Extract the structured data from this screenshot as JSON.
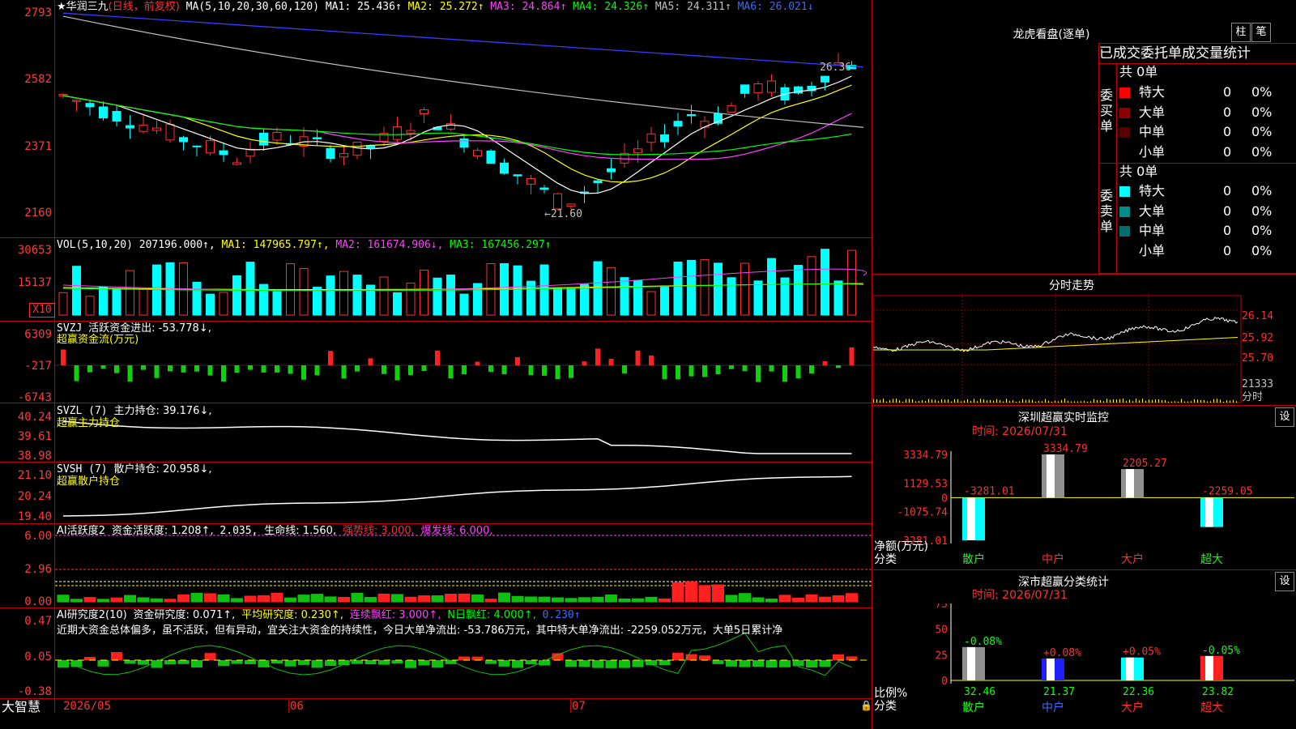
{
  "stock": {
    "name": "华润三九",
    "mode": "(日线，前复权)",
    "ma_label": "MA(5,10,20,30,60,120)",
    "ma1": "MA1: 25.436↑",
    "ma2": "MA2: 25.272↑",
    "ma3": "MA3: 24.864↑",
    "ma4": "MA4: 24.326↑",
    "ma5": "MA5: 24.311↑",
    "ma6": "MA6: 26.021↓",
    "y_ticks": [
      "2793",
      "2582",
      "2371",
      "2160"
    ],
    "high_mark": "26.36",
    "low_mark": "←21.60"
  },
  "vol": {
    "label": "VOL(5,10,20)",
    "value": "207196.000↑,",
    "ma1": "MA1: 147965.797↑,",
    "ma2": "MA2: 161674.906↓,",
    "ma3": "MA3: 167456.297↑",
    "y_ticks": [
      "30653",
      "15137"
    ],
    "unit": "X10"
  },
  "svzj": {
    "label": "SVZJ",
    "value": "活跃资金进出: -53.778↓,",
    "subtitle": "超赢资金流(万元)",
    "y_ticks": [
      "6309",
      "-217",
      "-6743"
    ]
  },
  "svzl": {
    "label": "SVZL (7)",
    "value": "主力持仓: 39.176↓,",
    "subtitle": "超赢主力持仓",
    "y_ticks": [
      "40.24",
      "39.61",
      "38.98"
    ]
  },
  "svsh": {
    "label": "SVSH (7)",
    "value": "散户持仓: 20.958↓,",
    "subtitle": "超赢散户持仓",
    "y_ticks": [
      "21.10",
      "20.24",
      "19.40"
    ]
  },
  "ai1": {
    "label": "AI活跃度2",
    "value": "资金活跃度: 1.208↑,",
    "v2": "2.035,",
    "v3": "生命线: 1.560,",
    "v4": "强势线: 3.000,",
    "v5": "爆发线: 6.000,",
    "y_ticks": [
      "6.00",
      "2.96",
      "0.00"
    ]
  },
  "ai2": {
    "label": "AI研究度2(10)",
    "value": "资金研究度: 0.071↑,",
    "v2": "平均研究度: 0.230↑,",
    "v3": "连续飘红: 3.000↑,",
    "v4": "N日飘红: 4.000↑,",
    "v5": "0.230↑",
    "commentary": "近期大资金总体偏多，虽不活跃，但有异动，宜关注大资金的持续性，今日大单净流出: -53.786万元，其中特大单净流出: -2259.052万元，大单5日累计净",
    "y_ticks": [
      "0.47",
      "0.05",
      "-0.38"
    ]
  },
  "x_axis": {
    "brand": "大智慧",
    "dates": [
      "2026/05",
      "06",
      "07"
    ]
  },
  "dragon": {
    "title": "龙虎看盘(逐单)",
    "btn1": "柱",
    "btn2": "笔",
    "tabs": "已成交委托单成交量统计",
    "buy_label": "委买单",
    "sell_label": "委卖单",
    "buy_total": "共 0单",
    "sell_total": "共 0单",
    "buy_rows": [
      {
        "name": "特大",
        "count": "0",
        "pct": "0%",
        "color": "#ff0000"
      },
      {
        "name": "大单",
        "count": "0",
        "pct": "0%",
        "color": "#8b0000"
      },
      {
        "name": "中单",
        "count": "0",
        "pct": "0%",
        "color": "#5a0000"
      },
      {
        "name": "小单",
        "count": "0",
        "pct": "0%",
        "color": "#000000"
      }
    ],
    "sell_rows": [
      {
        "name": "特大",
        "count": "0",
        "pct": "0%",
        "color": "#00ffff"
      },
      {
        "name": "大单",
        "count": "0",
        "pct": "0%",
        "color": "#008b8b"
      },
      {
        "name": "中单",
        "count": "0",
        "pct": "0%",
        "color": "#006e6e"
      },
      {
        "name": "小单",
        "count": "0",
        "pct": "0%",
        "color": "#000000"
      }
    ]
  },
  "intraday": {
    "title": "分时走势",
    "y_ticks": [
      "26.14",
      "25.92",
      "25.70",
      "21333"
    ],
    "footer": "分时"
  },
  "sz_monitor": {
    "title": "深圳超赢实时监控",
    "btn": "设",
    "time": "时间: 2026/07/31",
    "y_ticks": [
      "3334.79",
      "1129.53",
      "0",
      "-1075.74",
      "-3281.01"
    ],
    "ylabel": "净额(万元)",
    "xlabel": "分类",
    "bars": [
      {
        "cat": "散户",
        "value": -3281.01,
        "label": "-3281.01"
      },
      {
        "cat": "中户",
        "value": 3334.79,
        "label": "3334.79"
      },
      {
        "cat": "大户",
        "value": 2205.27,
        "label": "2205.27"
      },
      {
        "cat": "超大",
        "value": -2259.05,
        "label": "-2259.05"
      }
    ]
  },
  "sz_class": {
    "title": "深市超赢分类统计",
    "btn": "设",
    "time": "时间: 2026/07/31",
    "y_ticks": [
      "75",
      "50",
      "25",
      "0"
    ],
    "ylabel": "比例%",
    "xlabel": "分类",
    "bars": [
      {
        "cat": "散户",
        "value": 32.46,
        "label": "32.46",
        "change": "-0.08%"
      },
      {
        "cat": "中户",
        "value": 21.37,
        "label": "21.37",
        "change": "+0.08%"
      },
      {
        "cat": "大户",
        "value": 22.36,
        "label": "22.36",
        "change": "+0.05%"
      },
      {
        "cat": "超大",
        "value": 23.82,
        "label": "23.82",
        "change": "-0.05%"
      }
    ]
  }
}
